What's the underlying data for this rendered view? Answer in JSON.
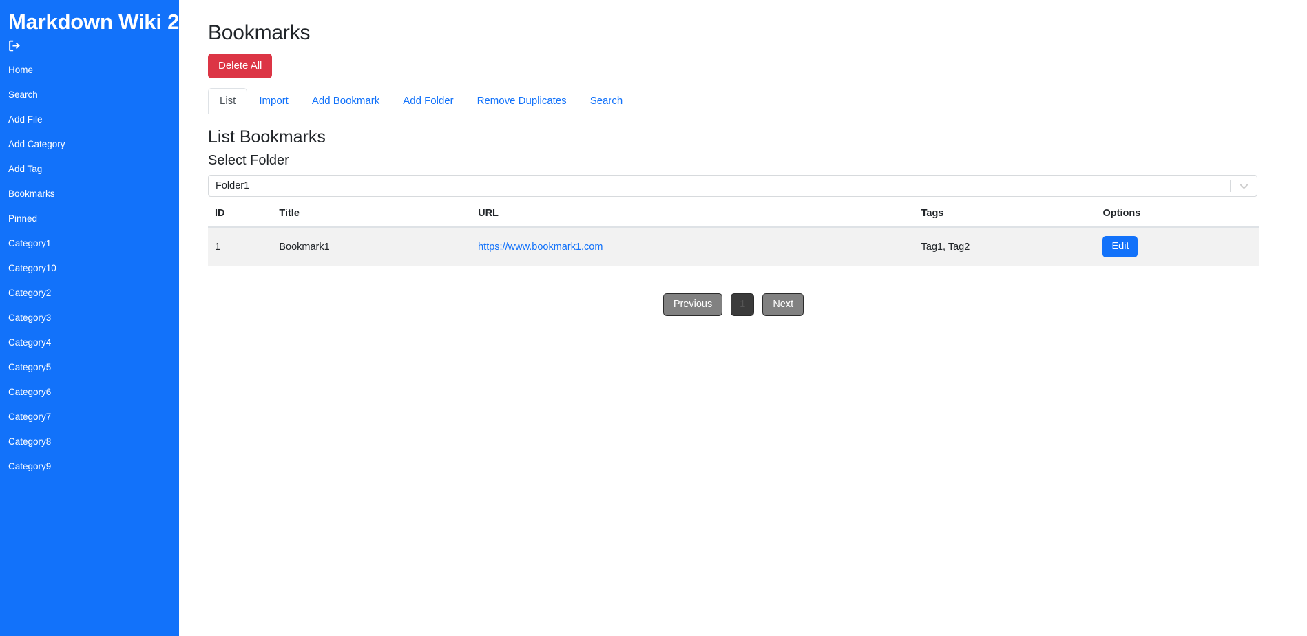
{
  "sidebar": {
    "title": "Markdown Wiki 2",
    "logout_icon": "sign-out-icon",
    "items": [
      {
        "label": "Home"
      },
      {
        "label": "Search"
      },
      {
        "label": "Add File"
      },
      {
        "label": "Add Category"
      },
      {
        "label": "Add Tag"
      },
      {
        "label": "Bookmarks"
      },
      {
        "label": "Pinned"
      },
      {
        "label": "Category1"
      },
      {
        "label": "Category10"
      },
      {
        "label": "Category2"
      },
      {
        "label": "Category3"
      },
      {
        "label": "Category4"
      },
      {
        "label": "Category5"
      },
      {
        "label": "Category6"
      },
      {
        "label": "Category7"
      },
      {
        "label": "Category8"
      },
      {
        "label": "Category9"
      }
    ],
    "background_color": "#1272fa"
  },
  "main": {
    "page_title": "Bookmarks",
    "delete_all_label": "Delete All",
    "delete_all_color": "#dc3545",
    "tabs": [
      {
        "label": "List",
        "active": true
      },
      {
        "label": "Import",
        "active": false
      },
      {
        "label": "Add Bookmark",
        "active": false
      },
      {
        "label": "Add Folder",
        "active": false
      },
      {
        "label": "Remove Duplicates",
        "active": false
      },
      {
        "label": "Search",
        "active": false
      }
    ],
    "section_heading": "List Bookmarks",
    "select_folder_label": "Select Folder",
    "folder_select": {
      "value": "Folder1",
      "options": [
        "Folder1"
      ],
      "chevron_icon": "chevron-down-icon"
    },
    "table": {
      "columns": [
        "ID",
        "Title",
        "URL",
        "Tags",
        "Options"
      ],
      "rows": [
        {
          "id": "1",
          "title": "Bookmark1",
          "url": "https://www.bookmark1.com",
          "tags": "Tag1, Tag2",
          "option_label": "Edit"
        }
      ]
    },
    "pagination": {
      "previous_label": "Previous",
      "current_page": "1",
      "next_label": "Next"
    }
  }
}
